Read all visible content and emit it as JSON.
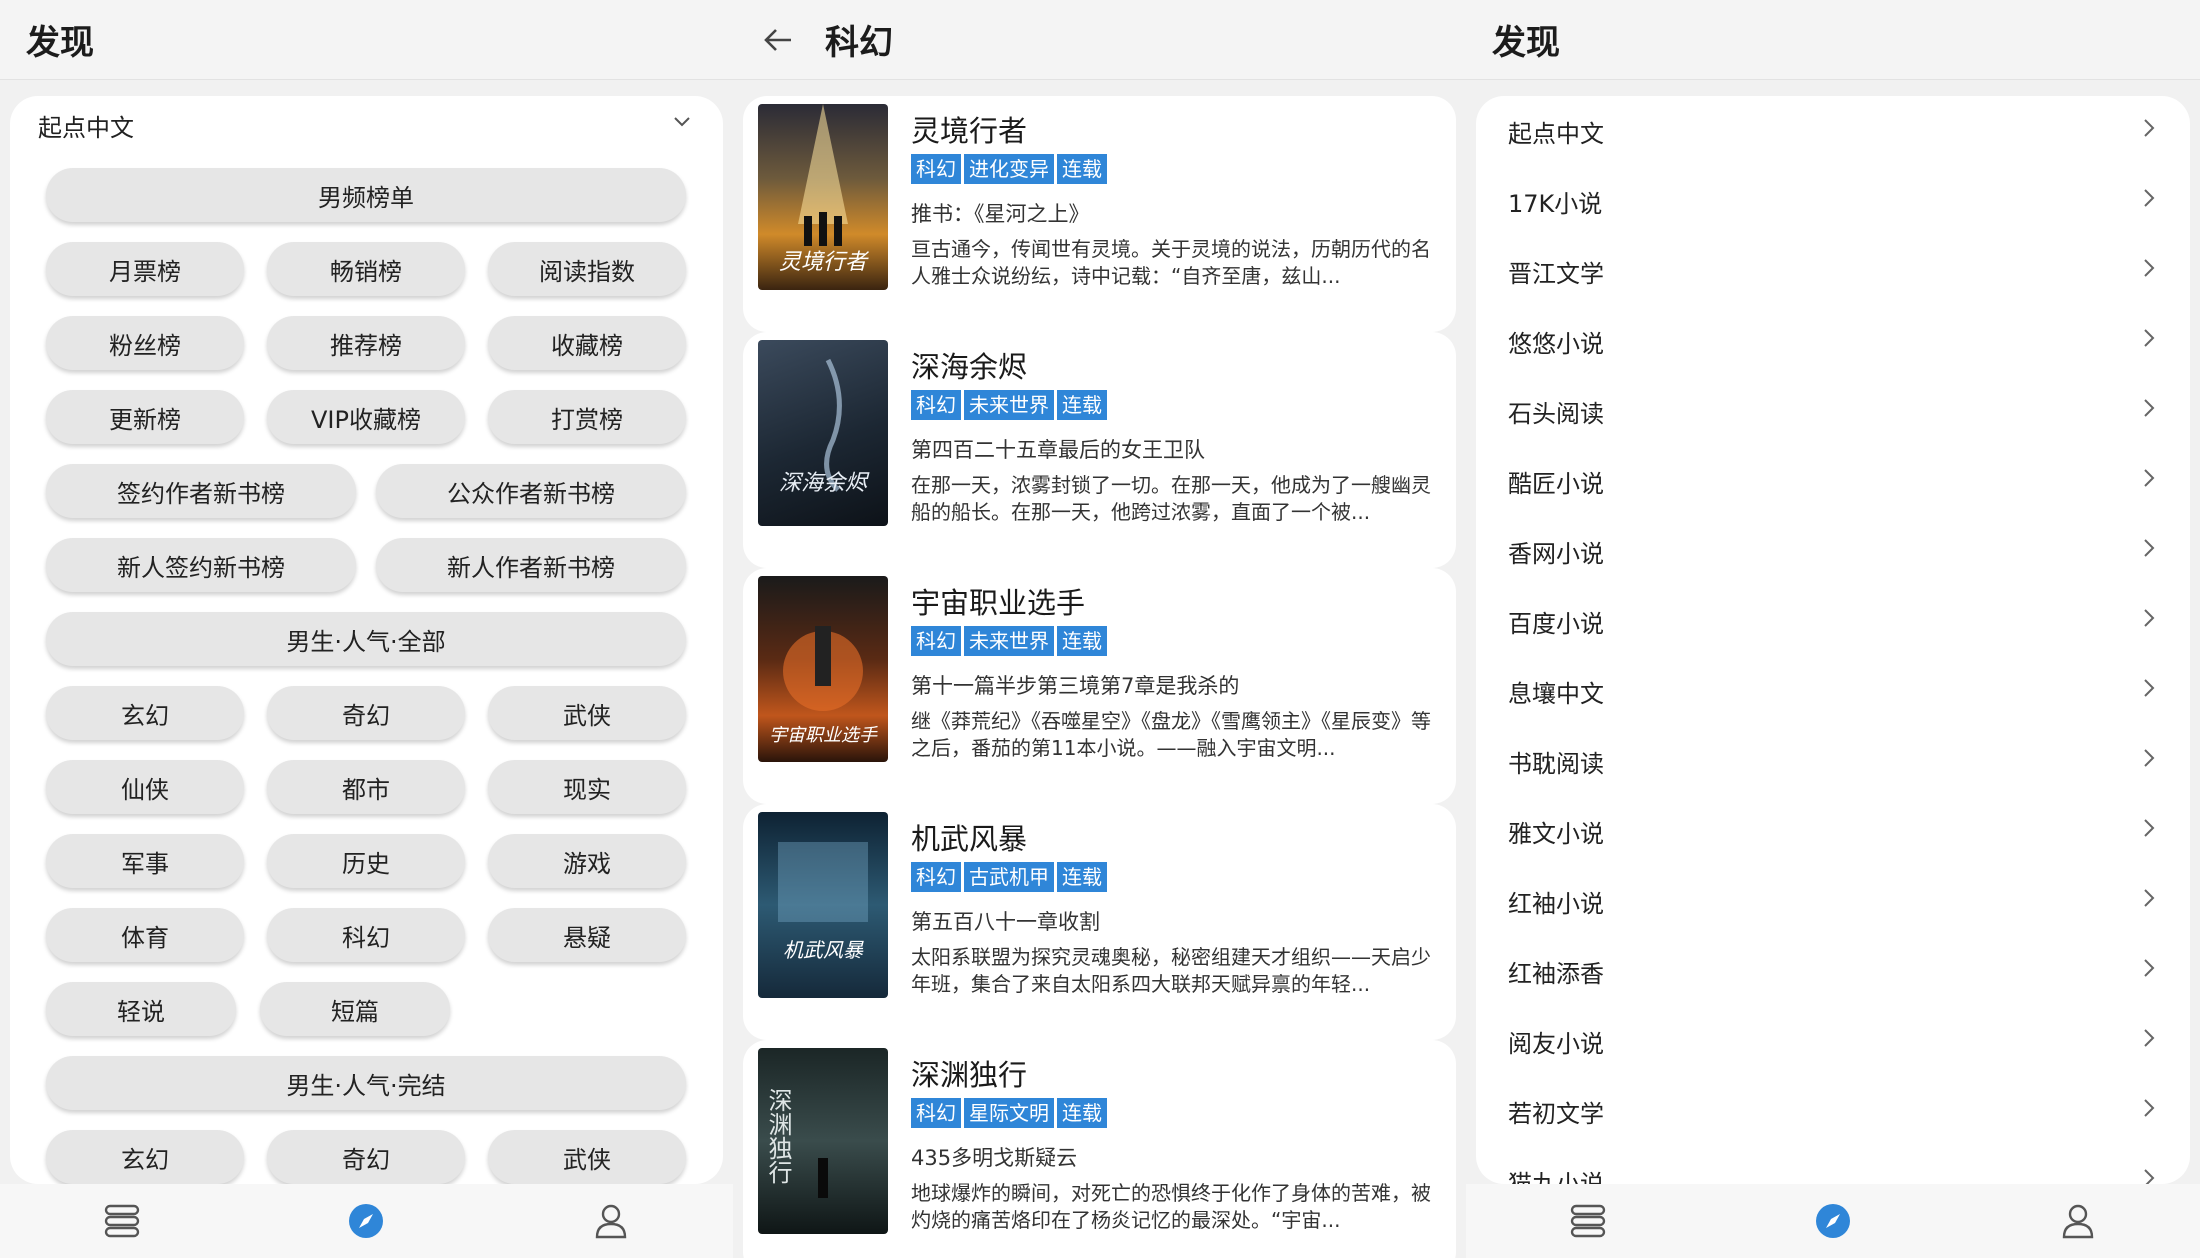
{
  "left": {
    "title": "发现",
    "source": "起点中文",
    "chips": [
      "男频榜单",
      "月票榜",
      "畅销榜",
      "阅读指数",
      "粉丝榜",
      "推荐榜",
      "收藏榜",
      "更新榜",
      "VIP收藏榜",
      "打赏榜",
      "签约作者新书榜",
      "公众作者新书榜",
      "新人签约新书榜",
      "新人作者新书榜",
      "男生·人气·全部",
      "玄幻",
      "奇幻",
      "武侠",
      "仙侠",
      "都市",
      "现实",
      "军事",
      "历史",
      "游戏",
      "体育",
      "科幻",
      "悬疑",
      "轻说",
      "短篇",
      "男生·人气·完结",
      "玄幻",
      "奇幻",
      "武侠"
    ]
  },
  "middle": {
    "title": "科幻",
    "books": [
      {
        "name": "灵境行者",
        "tags": [
          "科幻",
          "进化变异",
          "连载"
        ],
        "latest": "推书：《星河之上》",
        "intro": "亘古通今，传闻世有灵境。关于灵境的说法，历朝历代的名人雅士众说纷纭，诗中记载：“自齐至唐，兹山...",
        "cover_text": "灵境行者"
      },
      {
        "name": "深海余烬",
        "tags": [
          "科幻",
          "未来世界",
          "连载"
        ],
        "latest": "第四百二十五章最后的女王卫队",
        "intro": "在那一天，浓雾封锁了一切。在那一天，他成为了一艘幽灵船的船长。在那一天，他跨过浓雾，直面了一个被...",
        "cover_text": "深海余烬"
      },
      {
        "name": "宇宙职业选手",
        "tags": [
          "科幻",
          "未来世界",
          "连载"
        ],
        "latest": "第十一篇半步第三境第7章是我杀的",
        "intro": "继《莽荒纪》《吞噬星空》《盘龙》《雪鹰领主》《星辰变》等之后，番茄的第11本小说。——融入宇宙文明...",
        "cover_text": "宇宙职业选手"
      },
      {
        "name": "机武风暴",
        "tags": [
          "科幻",
          "古武机甲",
          "连载"
        ],
        "latest": "第五百八十一章收割",
        "intro": "太阳系联盟为探究灵魂奥秘，秘密组建天才组织——天启少年班，集合了来自太阳系四大联邦天赋异禀的年轻...",
        "cover_text": "机武风暴"
      },
      {
        "name": "深渊独行",
        "tags": [
          "科幻",
          "星际文明",
          "连载"
        ],
        "latest": "435多明戈斯疑云",
        "intro": "地球爆炸的瞬间，对死亡的恐惧终于化作了身体的苦难，被灼烧的痛苦烙印在了杨炎记忆的最深处。“宇宙...",
        "cover_text": "深渊独行"
      }
    ]
  },
  "right": {
    "title": "发现",
    "sources": [
      "起点中文",
      "17K小说",
      "晋江文学",
      "悠悠小说",
      "石头阅读",
      "酷匠小说",
      "香网小说",
      "百度小说",
      "息壤中文",
      "书耽阅读",
      "雅文小说",
      "红袖小说",
      "红袖添香",
      "阅友小说",
      "若初文学",
      "猫九小说"
    ]
  },
  "colors": {
    "tag": "#2f86d8",
    "active_nav": "#2f86d8"
  },
  "nav_icons": [
    "bookshelf-icon",
    "compass-icon",
    "person-icon"
  ]
}
